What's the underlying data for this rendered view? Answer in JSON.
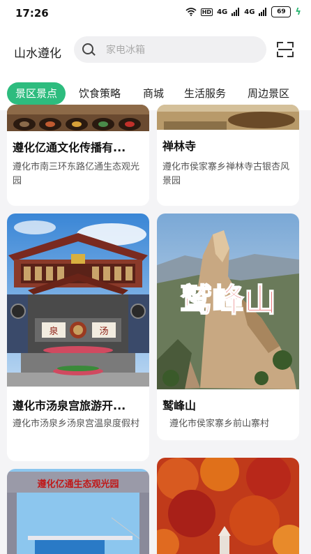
{
  "status_bar": {
    "time": "17:26",
    "hd": "HD",
    "signal1": "4G",
    "signal2": "4G",
    "battery": "69"
  },
  "header": {
    "city": "山水遵化",
    "search_placeholder": "家电冰箱"
  },
  "tabs": [
    "景区景点",
    "饮食策略",
    "商城",
    "生活服务",
    "周边景区"
  ],
  "cards": [
    {
      "title": "遵化亿通文化传播有...",
      "address": "遵化市南三环东路亿通生态观光园"
    },
    {
      "title": "禅林寺",
      "address": "遵化市侯家寨乡禅林寺古银杏风景园"
    },
    {
      "title": "遵化市汤泉宫旅游开...",
      "address": "遵化市汤泉乡汤泉宫温泉度假村",
      "image_text": [
        "泉",
        "汤"
      ]
    },
    {
      "title": "鹫峰山",
      "address": "遵化市侯家寨乡前山寨村",
      "image_text": "鹫峰山"
    },
    {
      "title": "",
      "address": "",
      "image_text": "遵化亿通生态观光园"
    },
    {
      "title": "",
      "address": ""
    }
  ]
}
